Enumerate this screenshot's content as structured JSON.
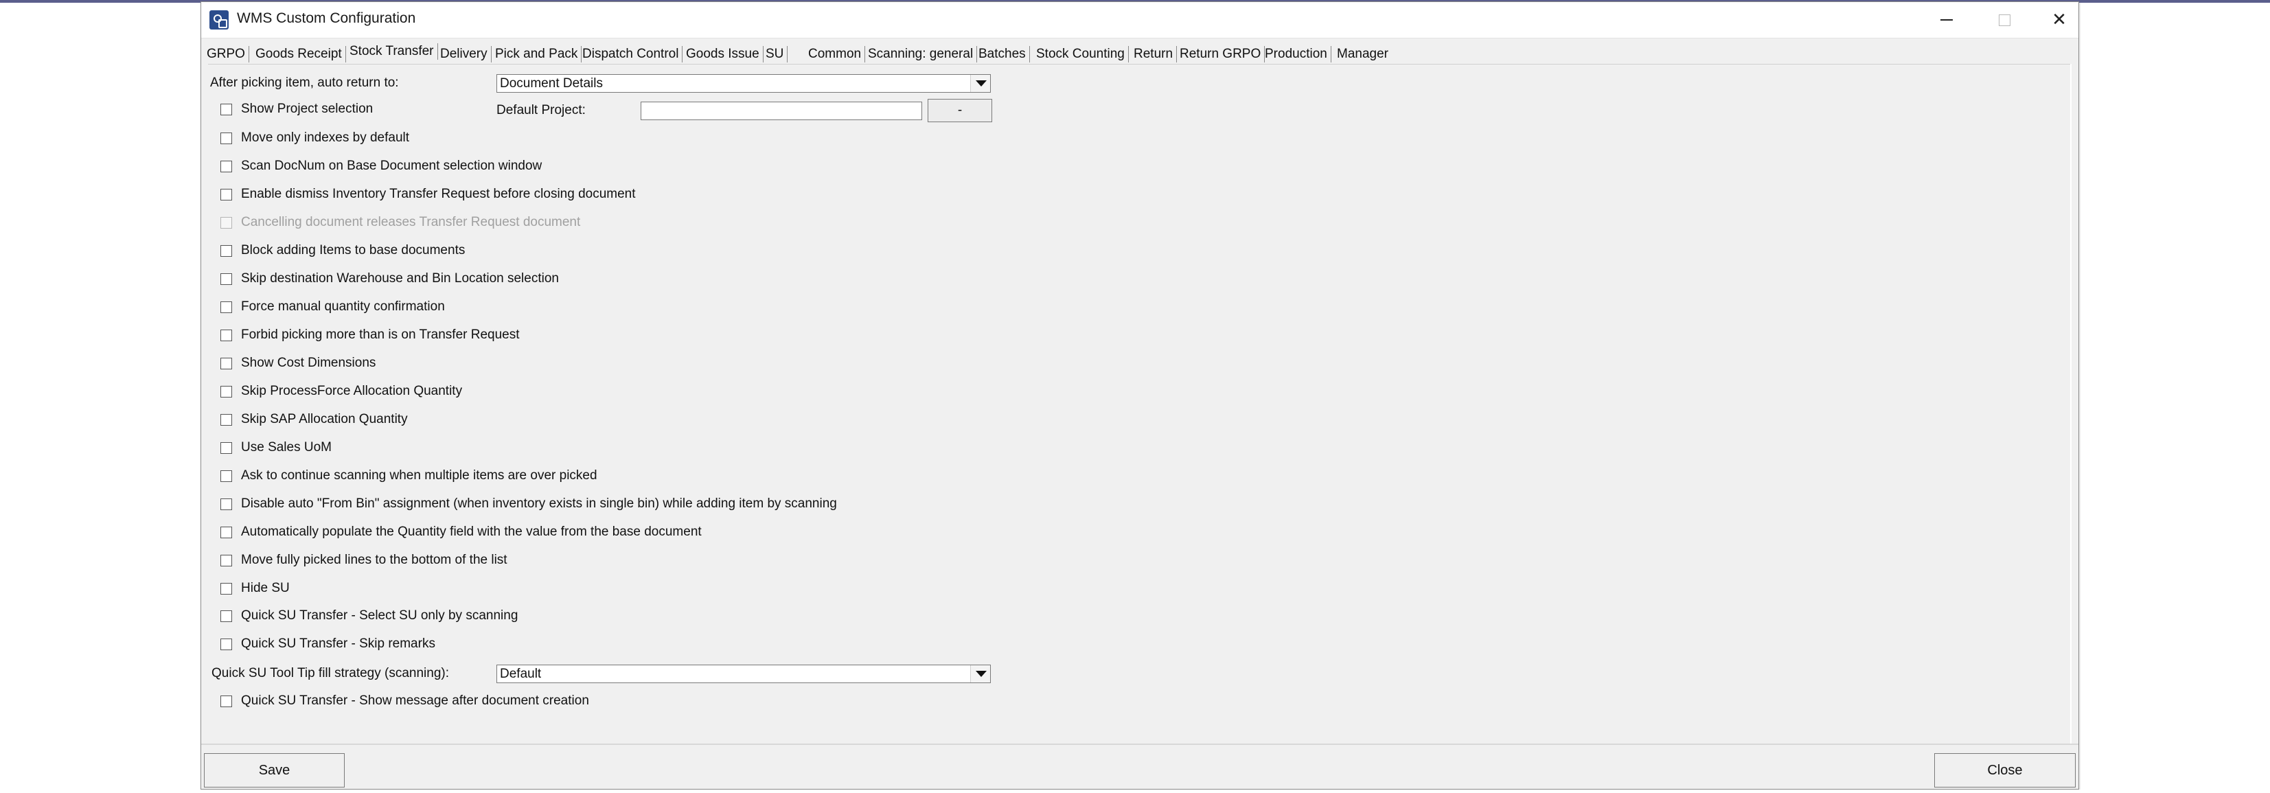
{
  "window": {
    "title": "WMS Custom Configuration",
    "icon": "app-icon",
    "controls": [
      "minimize-icon",
      "maximize-icon",
      "close-icon"
    ]
  },
  "tabs": [
    {
      "label": "GRPO"
    },
    {
      "label": "Goods Receipt"
    },
    {
      "label": "Stock Transfer",
      "active": true
    },
    {
      "label": "Delivery"
    },
    {
      "label": "Pick and Pack"
    },
    {
      "label": "Dispatch Control"
    },
    {
      "label": "Goods Issue"
    },
    {
      "label": "SU"
    },
    {
      "label": "Common"
    },
    {
      "label": "Scanning: general"
    },
    {
      "label": "Batches"
    },
    {
      "label": "Stock Counting"
    },
    {
      "label": "Return"
    },
    {
      "label": "Return GRPO"
    },
    {
      "label": "Production"
    },
    {
      "label": "Manager"
    }
  ],
  "settings": {
    "auto_return_label": "After picking item, auto return to:",
    "auto_return_value": "Document Details",
    "default_project_label": "Default Project:",
    "default_project_value": "",
    "default_project_button": "-",
    "quick_su_tooltip_label": "Quick SU Tool Tip fill strategy (scanning):",
    "quick_su_tooltip_value": "Default",
    "checkboxes": [
      {
        "label": "Show Project selection",
        "checked": false,
        "enabled": true
      },
      {
        "label": "Move only indexes by default",
        "checked": false,
        "enabled": true
      },
      {
        "label": "Scan DocNum on Base Document selection window",
        "checked": false,
        "enabled": true
      },
      {
        "label": "Enable dismiss Inventory Transfer Request before closing document",
        "checked": false,
        "enabled": true
      },
      {
        "label": "Cancelling document releases Transfer Request document",
        "checked": false,
        "enabled": false
      },
      {
        "label": "Block adding Items to base documents",
        "checked": false,
        "enabled": true
      },
      {
        "label": "Skip destination Warehouse and Bin Location selection",
        "checked": false,
        "enabled": true
      },
      {
        "label": "Force manual quantity confirmation",
        "checked": false,
        "enabled": true
      },
      {
        "label": "Forbid picking more than is on Transfer Request",
        "checked": false,
        "enabled": true
      },
      {
        "label": "Show Cost Dimensions",
        "checked": false,
        "enabled": true
      },
      {
        "label": "Skip ProcessForce Allocation Quantity",
        "checked": false,
        "enabled": true
      },
      {
        "label": "Skip SAP Allocation Quantity",
        "checked": false,
        "enabled": true
      },
      {
        "label": "Use Sales UoM",
        "checked": false,
        "enabled": true
      },
      {
        "label": "Ask to continue scanning when multiple items are over picked",
        "checked": false,
        "enabled": true
      },
      {
        "label": "Disable auto \"From Bin\" assignment (when inventory exists in single bin) while adding item by scanning",
        "checked": false,
        "enabled": true
      },
      {
        "label": "Automatically populate the Quantity field with the value from the base document",
        "checked": false,
        "enabled": true
      },
      {
        "label": "Move fully picked lines to the bottom of the list",
        "checked": false,
        "enabled": true
      },
      {
        "label": "Hide SU",
        "checked": false,
        "enabled": true
      },
      {
        "label": "Quick SU Transfer - Select SU only by scanning",
        "checked": false,
        "enabled": true
      },
      {
        "label": "Quick SU Transfer - Skip remarks",
        "checked": false,
        "enabled": true
      },
      {
        "label": "Quick SU Transfer - Show message after document creation",
        "checked": false,
        "enabled": true
      }
    ]
  },
  "footer": {
    "save_label": "Save",
    "close_label": "Close"
  }
}
